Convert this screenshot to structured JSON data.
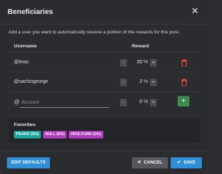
{
  "header": {
    "title": "Beneficiaries",
    "close_icon": "close-icon"
  },
  "description": "Add a user you want to automatically receive a portion of the rewards for this post.",
  "columns": {
    "username": "Username",
    "reward": "Reward"
  },
  "beneficiaries": [
    {
      "username": "@lmac",
      "reward": "20",
      "unit": "%"
    },
    {
      "username": "@sachingeorge",
      "reward": "2",
      "unit": "%"
    }
  ],
  "new_entry": {
    "at": "@",
    "placeholder": "Account",
    "reward": "0",
    "unit": "%"
  },
  "stepper": {
    "minus": "-",
    "plus": "+"
  },
  "add_label": "+",
  "favorites": {
    "title": "Favorites:",
    "chips": [
      {
        "label": "PEAKD (5%)",
        "color": "#1aa59a"
      },
      {
        "label": "NULL (5%)",
        "color": "#b23bbf"
      },
      {
        "label": "HIVE.FUND (5%)",
        "color": "#b23bbf"
      }
    ]
  },
  "footer": {
    "edit_defaults": "EDIT DEFAULTS",
    "cancel": "CANCEL",
    "save": "SAVE"
  },
  "colors": {
    "accent": "#2f8fd8",
    "danger": "#e84b3c",
    "add": "#3d8b4f"
  }
}
